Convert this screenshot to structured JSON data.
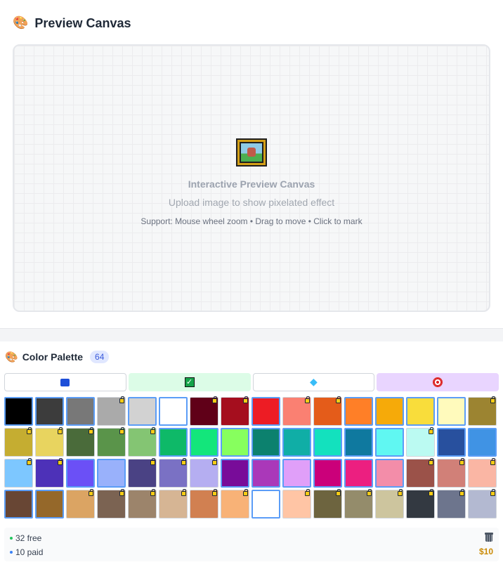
{
  "preview": {
    "title": "Preview Canvas",
    "title_icon": "palette-emoji",
    "empty_state": {
      "icon": "framed-picture-icon",
      "heading": "Interactive Preview Canvas",
      "subtitle": "Upload image to show pixelated effect",
      "hint": "Support: Mouse wheel zoom • Drag to move • Click to mark"
    }
  },
  "palette": {
    "title": "Color Palette",
    "count": "64",
    "tabs": [
      {
        "icon": "free-icon",
        "active": false
      },
      {
        "icon": "check-icon",
        "active": true
      },
      {
        "icon": "gem-icon",
        "active": false
      },
      {
        "icon": "target-icon",
        "active": true
      }
    ],
    "swatches": [
      {
        "color": "#000000",
        "paid": false
      },
      {
        "color": "#3c3c3c",
        "paid": false
      },
      {
        "color": "#787878",
        "paid": false
      },
      {
        "color": "#aaaaaa",
        "paid": true
      },
      {
        "color": "#d2d2d2",
        "paid": false
      },
      {
        "color": "#ffffff",
        "paid": false
      },
      {
        "color": "#600018",
        "paid": true
      },
      {
        "color": "#a50e1e",
        "paid": true
      },
      {
        "color": "#ed1c24",
        "paid": false
      },
      {
        "color": "#fa8072",
        "paid": true
      },
      {
        "color": "#e45c1a",
        "paid": true
      },
      {
        "color": "#ff7f27",
        "paid": false
      },
      {
        "color": "#f6aa09",
        "paid": false
      },
      {
        "color": "#f9dd3b",
        "paid": false
      },
      {
        "color": "#fffabc",
        "paid": false
      },
      {
        "color": "#9c8431",
        "paid": true
      },
      {
        "color": "#c5ad31",
        "paid": true
      },
      {
        "color": "#e8d45f",
        "paid": true
      },
      {
        "color": "#4a6b3a",
        "paid": true
      },
      {
        "color": "#5a944a",
        "paid": true
      },
      {
        "color": "#84c573",
        "paid": true
      },
      {
        "color": "#0eb968",
        "paid": false
      },
      {
        "color": "#13e67b",
        "paid": false
      },
      {
        "color": "#87ff5e",
        "paid": false
      },
      {
        "color": "#0c816e",
        "paid": false
      },
      {
        "color": "#10aea6",
        "paid": false
      },
      {
        "color": "#13e1be",
        "paid": false
      },
      {
        "color": "#0f799f",
        "paid": false
      },
      {
        "color": "#60f7f2",
        "paid": false
      },
      {
        "color": "#bbfaf2",
        "paid": true
      },
      {
        "color": "#28509e",
        "paid": false
      },
      {
        "color": "#4093e4",
        "paid": false
      },
      {
        "color": "#7dc7ff",
        "paid": true
      },
      {
        "color": "#4d31b8",
        "paid": true
      },
      {
        "color": "#6b50f6",
        "paid": false
      },
      {
        "color": "#99b1fb",
        "paid": false
      },
      {
        "color": "#4a4284",
        "paid": true
      },
      {
        "color": "#7a71c4",
        "paid": true
      },
      {
        "color": "#b5aef1",
        "paid": true
      },
      {
        "color": "#780c99",
        "paid": false
      },
      {
        "color": "#aa38b9",
        "paid": false
      },
      {
        "color": "#e09ff9",
        "paid": false
      },
      {
        "color": "#cb007a",
        "paid": false
      },
      {
        "color": "#ec1f80",
        "paid": false
      },
      {
        "color": "#f38da9",
        "paid": false
      },
      {
        "color": "#9b5249",
        "paid": true
      },
      {
        "color": "#d18078",
        "paid": true
      },
      {
        "color": "#fab6a4",
        "paid": true
      },
      {
        "color": "#684634",
        "paid": false
      },
      {
        "color": "#95682a",
        "paid": false
      },
      {
        "color": "#dba463",
        "paid": true
      },
      {
        "color": "#7b6352",
        "paid": true
      },
      {
        "color": "#9c846b",
        "paid": true
      },
      {
        "color": "#d6b594",
        "paid": true
      },
      {
        "color": "#d18051",
        "paid": true
      },
      {
        "color": "#f8b277",
        "paid": true
      },
      {
        "color": "#ffffff",
        "paid": false
      },
      {
        "color": "#ffc5a5",
        "paid": true
      },
      {
        "color": "#6d643f",
        "paid": true
      },
      {
        "color": "#948c6b",
        "paid": true
      },
      {
        "color": "#cdc59e",
        "paid": true
      },
      {
        "color": "#333941",
        "paid": true
      },
      {
        "color": "#6d758d",
        "paid": true
      },
      {
        "color": "#b3b9d1",
        "paid": true
      }
    ],
    "stats": {
      "free": "32 free",
      "free_dot_color": "#22c55e",
      "paid": "10 paid",
      "paid_dot_color": "#3b82f6",
      "price": "$10"
    }
  }
}
